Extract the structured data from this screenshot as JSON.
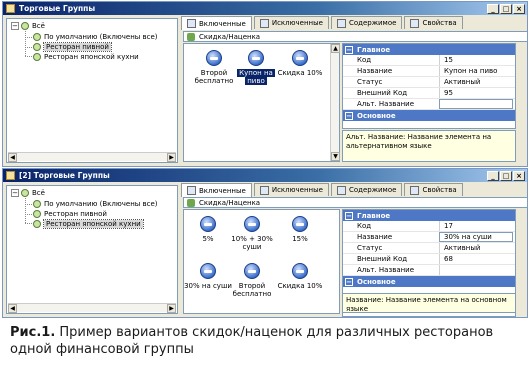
{
  "window1": {
    "title": "Торговые Группы",
    "window_buttons": [
      "_",
      "□",
      "×"
    ],
    "tree": {
      "root": "Всё",
      "items": [
        {
          "label": "По умолчанию (Включены все)",
          "selected": false
        },
        {
          "label": "Ресторан пивной",
          "selected": true
        },
        {
          "label": "Ресторан японской кухни",
          "selected": false
        }
      ]
    },
    "tabs": [
      {
        "label": "Включенные",
        "icon": "include-icon",
        "active": true
      },
      {
        "label": "Исключенные",
        "icon": "exclude-icon",
        "active": false
      },
      {
        "label": "Содержимое",
        "icon": "content-icon",
        "active": false
      },
      {
        "label": "Свойства",
        "icon": "properties-icon",
        "active": false
      }
    ],
    "breadcrumb": "Скидка/Наценка",
    "discounts": [
      {
        "label_lines": [
          "Второй",
          "бесплатно"
        ],
        "selected": false
      },
      {
        "label_lines": [
          "Купон на",
          "пиво"
        ],
        "selected": true
      },
      {
        "label_lines": [
          "Скидка 10%"
        ],
        "selected": false
      }
    ],
    "properties": {
      "section1": "Главное",
      "rows": [
        {
          "key": "Код",
          "value": "15",
          "input": false
        },
        {
          "key": "Название",
          "value": "Купон на пиво",
          "input": false
        },
        {
          "key": "Статус",
          "value": "Активный",
          "input": false
        },
        {
          "key": "Внешний Код",
          "value": "95",
          "input": false
        },
        {
          "key": "Альт. Название",
          "value": "",
          "input": true
        }
      ],
      "section2": "Основное"
    },
    "description": "Альт. Название: Название элемента на альтернативном языке"
  },
  "window2": {
    "title": "[2] Торговые Группы",
    "window_buttons": [
      "_",
      "□",
      "×"
    ],
    "tree": {
      "root": "Всё",
      "items": [
        {
          "label": "По умолчанию (Включены все)",
          "selected": false
        },
        {
          "label": "Ресторан пивной",
          "selected": false
        },
        {
          "label": "Ресторан японской кухни",
          "selected": true
        }
      ]
    },
    "tabs": [
      {
        "label": "Включенные",
        "icon": "include-icon",
        "active": true
      },
      {
        "label": "Исключенные",
        "icon": "exclude-icon",
        "active": false
      },
      {
        "label": "Содержимое",
        "icon": "content-icon",
        "active": false
      },
      {
        "label": "Свойства",
        "icon": "properties-icon",
        "active": false
      }
    ],
    "breadcrumb": "Скидка/Наценка",
    "discounts": [
      {
        "label_lines": [
          "5%"
        ],
        "selected": false
      },
      {
        "label_lines": [
          "10% + 30%",
          "суши"
        ],
        "selected": false
      },
      {
        "label_lines": [
          "15%"
        ],
        "selected": false
      },
      {
        "label_lines": [
          "30% на суши"
        ],
        "selected": false
      },
      {
        "label_lines": [
          "Второй",
          "бесплатно"
        ],
        "selected": false
      },
      {
        "label_lines": [
          "Скидка 10%"
        ],
        "selected": false
      }
    ],
    "properties": {
      "section1": "Главное",
      "rows": [
        {
          "key": "Код",
          "value": "17",
          "input": false
        },
        {
          "key": "Название",
          "value": "30% на суши",
          "input": true
        },
        {
          "key": "Статус",
          "value": "Активный",
          "input": false
        },
        {
          "key": "Внешний Код",
          "value": "68",
          "input": false
        },
        {
          "key": "Альт. Название",
          "value": "",
          "input": false
        }
      ],
      "section2": "Основное"
    },
    "description": "Название: Название элемента на основном языке"
  },
  "caption": {
    "fig": "Рис.1.",
    "text": " Пример вариантов скидок/наценок для различных ресторанов одной финансовой группы"
  },
  "colors": {
    "titlebar": "#0a246a",
    "section": "#4e78c5",
    "selection": "#0a246a",
    "description_bg": "#ffffe1"
  }
}
